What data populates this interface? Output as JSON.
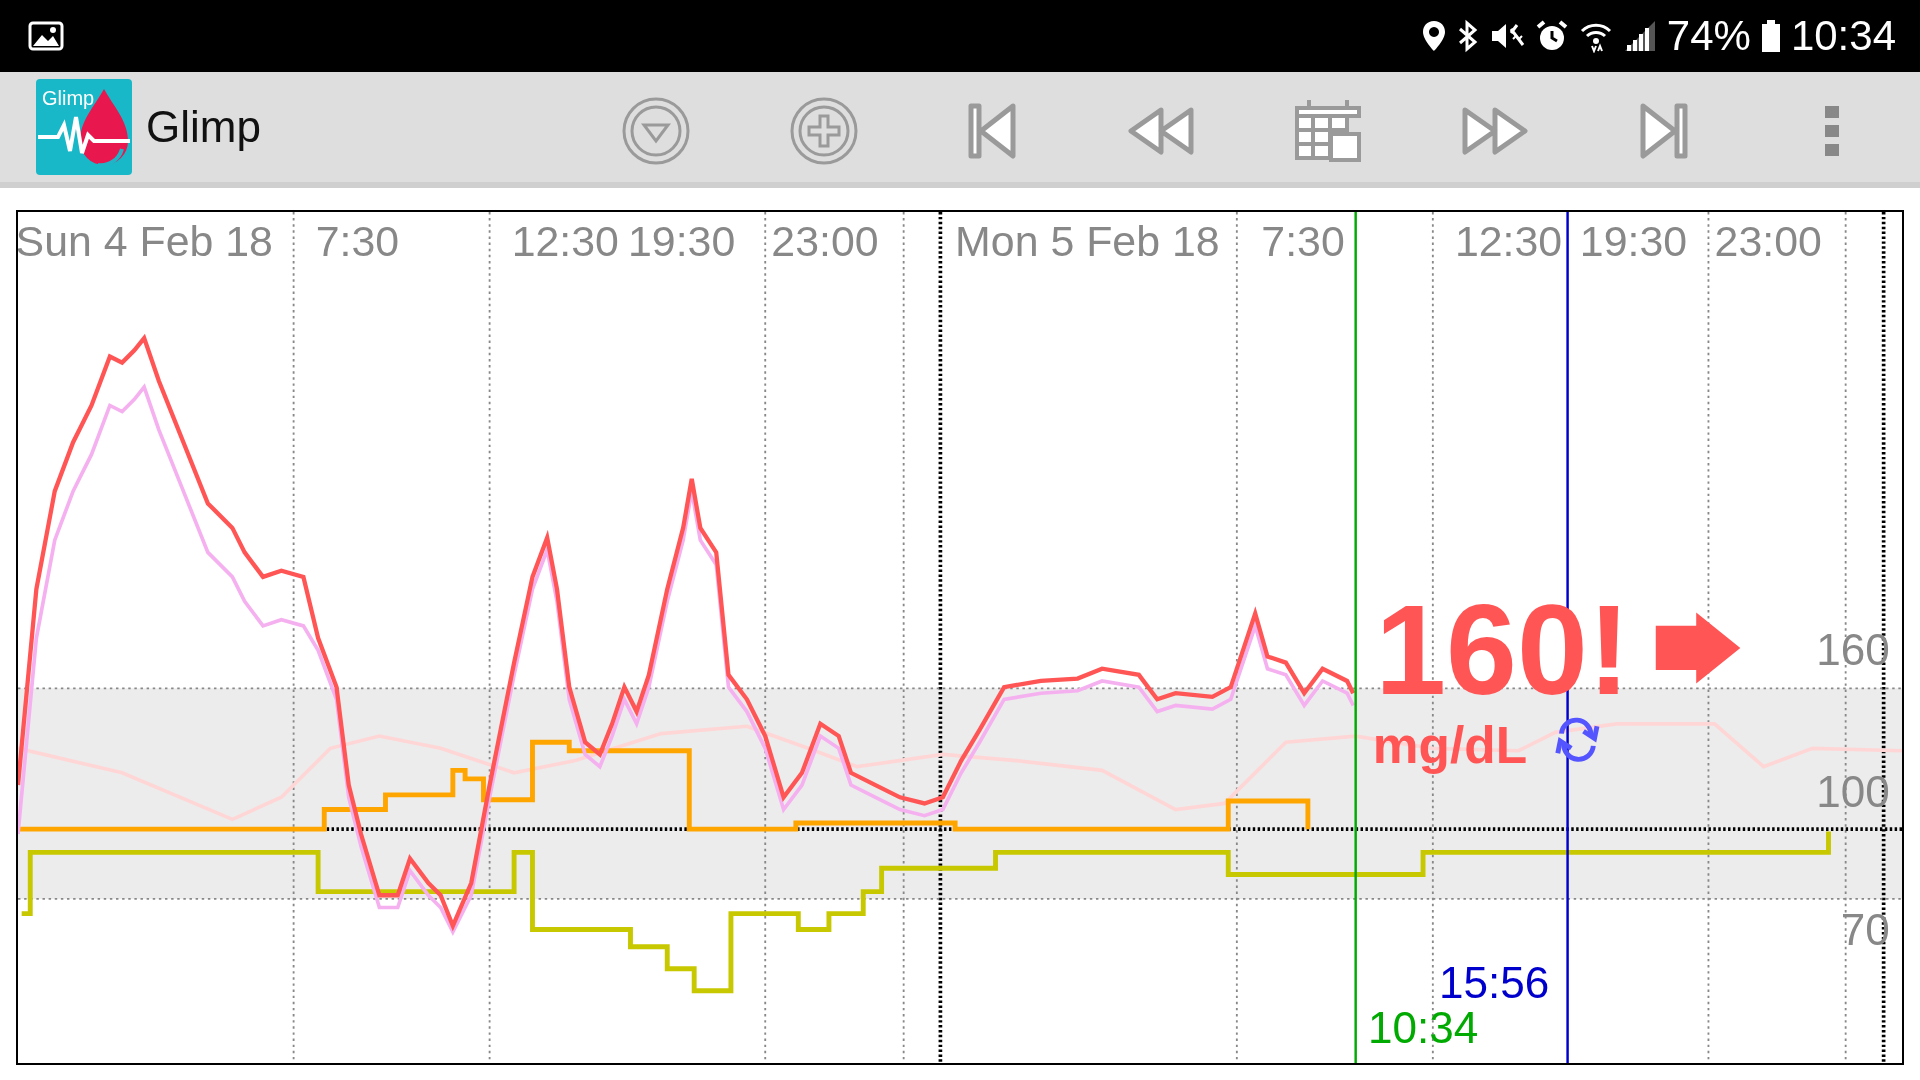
{
  "status_bar": {
    "battery": "74%",
    "time": "10:34"
  },
  "toolbar": {
    "logo_text": "Glimp",
    "app_name": "Glimp",
    "buttons": [
      {
        "kind": "collapse"
      },
      {
        "kind": "add"
      },
      {
        "kind": "first"
      },
      {
        "kind": "rewind"
      },
      {
        "kind": "calendar"
      },
      {
        "kind": "forward"
      },
      {
        "kind": "last"
      },
      {
        "kind": "more"
      }
    ]
  },
  "chart": {
    "x_labels": [
      "Sun 4 Feb 18",
      "7:30",
      "12:30",
      "19:30",
      "23:00",
      "Mon 5 Feb 18",
      "7:30",
      "12:30",
      "19:30",
      "23:00"
    ],
    "y_labels": [
      "160",
      "100",
      "70"
    ],
    "reading": {
      "value": "160!",
      "unit": "mg/dL"
    },
    "cursors": [
      {
        "time": "15:56",
        "color": "#0000cc"
      },
      {
        "time": "10:34",
        "color": "#00aa00"
      }
    ]
  }
}
